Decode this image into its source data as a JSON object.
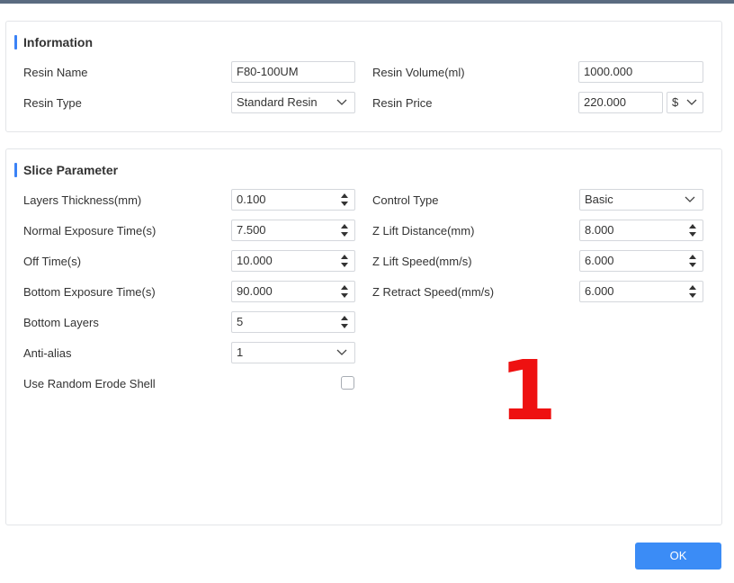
{
  "information": {
    "title": "Information",
    "resin_name_label": "Resin Name",
    "resin_name_value": "F80-100UM",
    "resin_volume_label": "Resin Volume(ml)",
    "resin_volume_value": "1000.000",
    "resin_type_label": "Resin Type",
    "resin_type_value": "Standard Resin",
    "resin_price_label": "Resin Price",
    "resin_price_value": "220.000",
    "currency_value": "$"
  },
  "slice": {
    "title": "Slice Parameter",
    "layers_thickness_label": "Layers Thickness(mm)",
    "layers_thickness_value": "0.100",
    "normal_exposure_label": "Normal Exposure Time(s)",
    "normal_exposure_value": "7.500",
    "off_time_label": "Off Time(s)",
    "off_time_value": "10.000",
    "bottom_exposure_label": "Bottom Exposure Time(s)",
    "bottom_exposure_value": "90.000",
    "bottom_layers_label": "Bottom Layers",
    "bottom_layers_value": "5",
    "anti_alias_label": "Anti-alias",
    "anti_alias_value": "1",
    "random_erode_label": "Use Random Erode Shell",
    "random_erode_checked": false,
    "control_type_label": "Control Type",
    "control_type_value": "Basic",
    "z_lift_distance_label": "Z Lift Distance(mm)",
    "z_lift_distance_value": "8.000",
    "z_lift_speed_label": "Z Lift Speed(mm/s)",
    "z_lift_speed_value": "6.000",
    "z_retract_speed_label": "Z Retract Speed(mm/s)",
    "z_retract_speed_value": "6.000"
  },
  "annotation": {
    "marker": "1",
    "color": "#ee1111"
  },
  "footer": {
    "ok_label": "OK"
  },
  "colors": {
    "accent": "#3b82f6",
    "ok_button": "#3b8cf6"
  }
}
